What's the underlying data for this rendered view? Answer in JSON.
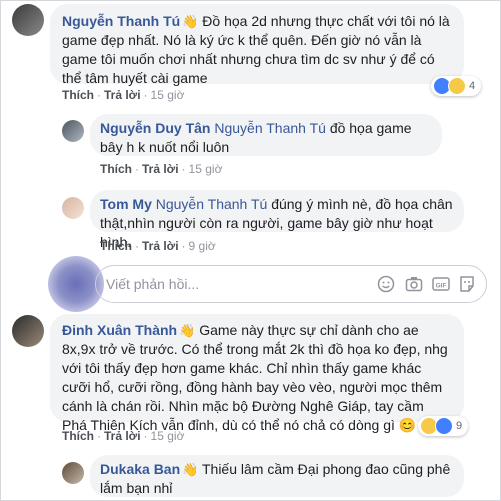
{
  "actions": {
    "like": "Thích",
    "reply": "Trả lời"
  },
  "comments": [
    {
      "author": "Nguyễn Thanh Tú",
      "text": "Đồ họa 2d nhưng thực chất với tôi nó là game đẹp nhất. Nó là ký ức k thể quên. Đến giờ nó vẫn là game tôi muốn chơi nhất nhưng chưa tìm dc sv như ý để có thể tâm huyết cài game",
      "time": "15 giờ",
      "reactions": "4"
    },
    {
      "author": "Nguyễn Duy Tân",
      "mention": "Nguyễn Thanh Tú",
      "text": "đồ họa game bây h k nuốt nổi luôn",
      "time": "15 giờ"
    },
    {
      "author": "Tom My",
      "mention": "Nguyễn Thanh Tú",
      "text": "đúng ý mình nè, đồ họa chân thật,nhìn người còn ra người, game bây giờ như hoạt hình.",
      "time": "9 giờ"
    },
    {
      "author": "Đinh Xuân Thành",
      "text": "Game này thực sự chỉ dành cho ae 8x,9x trở về trước. Có thể trong mắt 2k thì đồ họa ko đẹp, nhg với tôi thấy đẹp hơn game khác. Chỉ nhìn thấy game khác cưỡi hổ, cưỡi rồng, đồng hành bay vèo vèo, người mọc thêm cánh là chán rồi. Nhìn mặc bộ Đường Nghê Giáp, tay cầm Phá Thiên Kích vẫn đỉnh, dù có thể nó chả có dòng gì",
      "emoji": "😊",
      "time": "15 giờ",
      "reactions": "9"
    },
    {
      "author": "Dukaka Ban",
      "text": "Thiếu lâm cầm Đại phong đao cũng phê lắm bạn nhỉ"
    }
  ],
  "reply_box": {
    "placeholder": "Viết phản hồi..."
  }
}
